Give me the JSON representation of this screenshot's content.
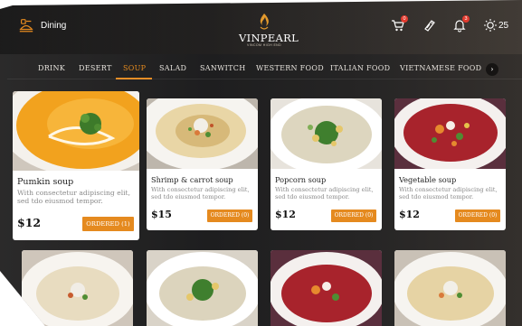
{
  "header": {
    "section_label": "Dining",
    "section_icon": "dining-service-icon",
    "logo_text": "VINPEARL",
    "logo_subtext": "VINCOM HIGH END",
    "cart_badge": "0",
    "notification_badge": "3",
    "weather_text": "25"
  },
  "nav": {
    "tabs": [
      "DRINK",
      "DESERT",
      "SOUP",
      "SALAD",
      "SANWITCH",
      "WESTERN FOOD",
      "ITALIAN FOOD",
      "VIETNAMESE FOOD"
    ],
    "active_tab": "SOUP",
    "next_icon": "chevron-right-icon"
  },
  "accent_color": "#e58a1f",
  "cards": [
    {
      "name": "Pumkin soup",
      "description": "With consectetur adipiscing elit, sed tdo eiusmod tempor.",
      "price": "$12",
      "ordered_label": "ORDERED (1)"
    },
    {
      "name": "Shrimp & carrot soup",
      "description": "With consectetur adipiscing elit, sed tdo eiusmod tempor.",
      "price": "$15",
      "ordered_label": "ORDERED (0)"
    },
    {
      "name": "Popcorn soup",
      "description": "With consectetur adipiscing elit, sed tdo eiusmod tempor.",
      "price": "$12",
      "ordered_label": "ORDERED (0)"
    },
    {
      "name": "Vegetable soup",
      "description": "With consectetur adipiscing elit, sed tdo eiusmod tempor.",
      "price": "$12",
      "ordered_label": "ORDERED (0)"
    }
  ]
}
